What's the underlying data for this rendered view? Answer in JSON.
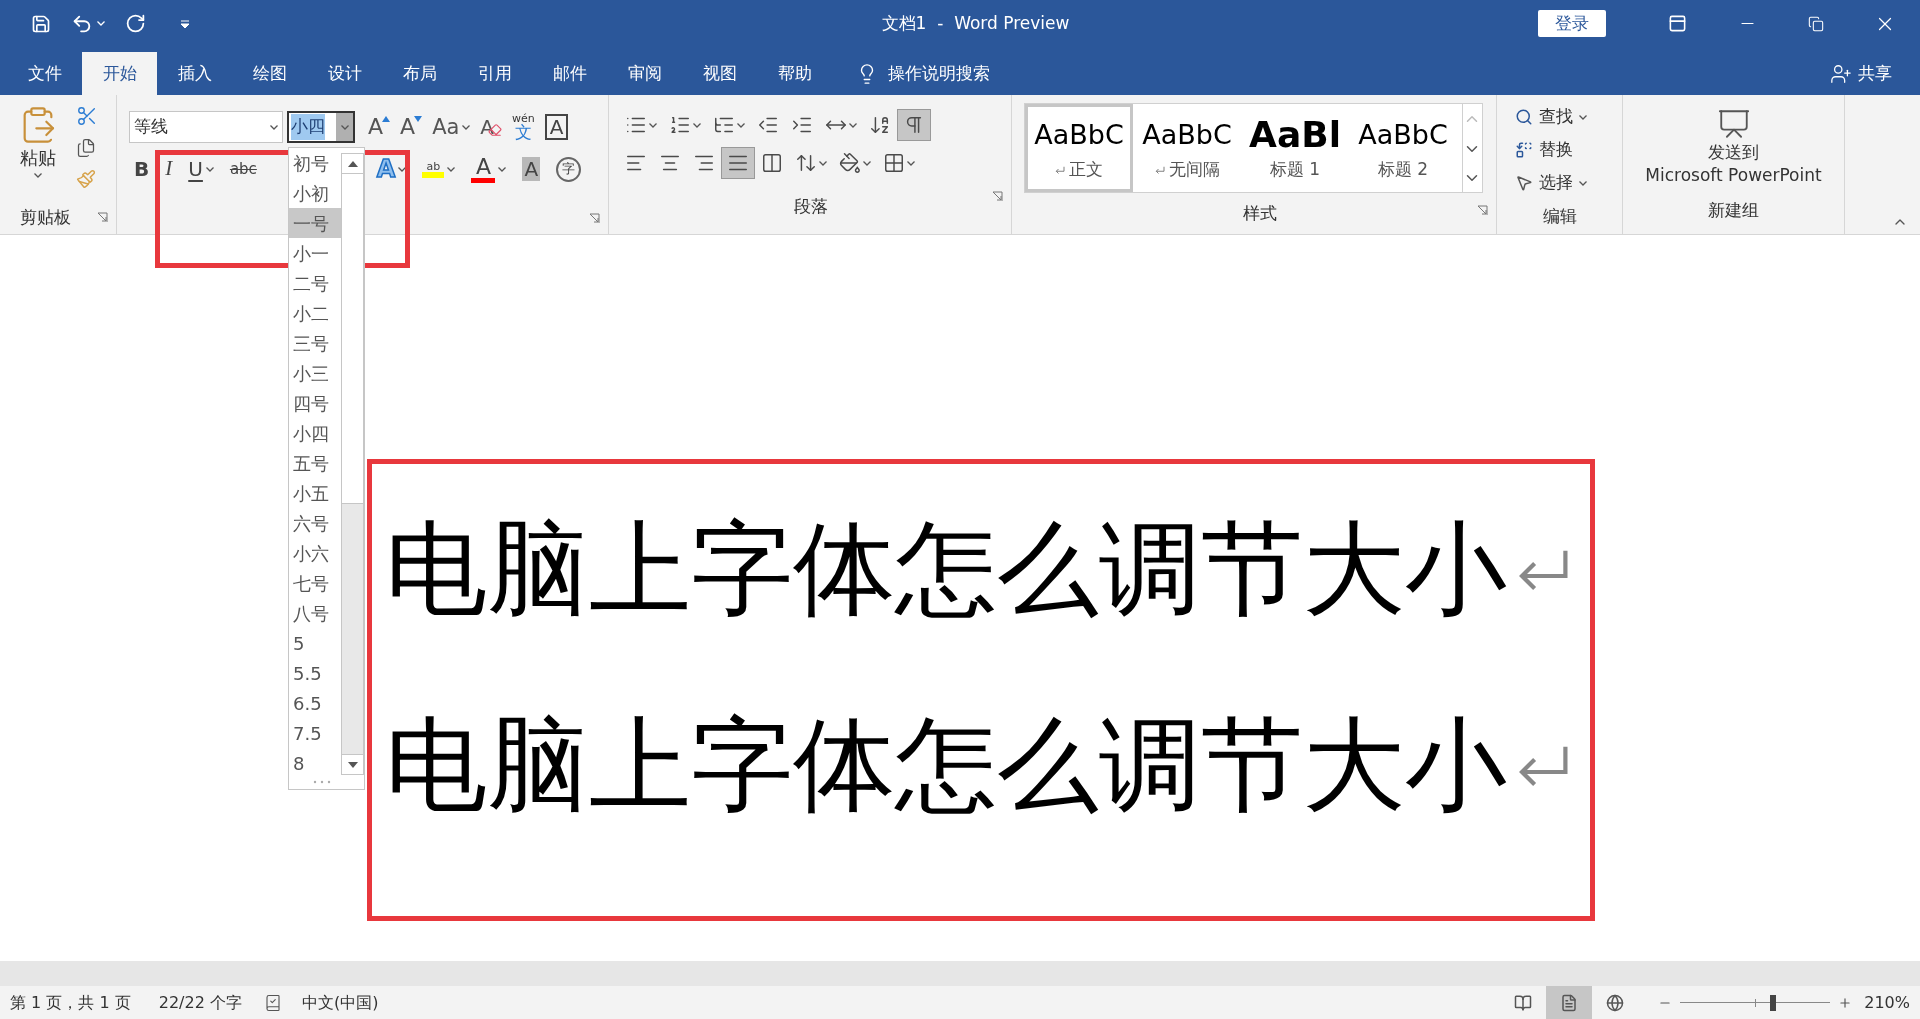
{
  "title_bar": {
    "title": "文档1  -  Word Preview",
    "sign_in": "登录"
  },
  "tabs": [
    {
      "label": "文件",
      "selected": false
    },
    {
      "label": "开始",
      "selected": true
    },
    {
      "label": "插入",
      "selected": false
    },
    {
      "label": "绘图",
      "selected": false
    },
    {
      "label": "设计",
      "selected": false
    },
    {
      "label": "布局",
      "selected": false
    },
    {
      "label": "引用",
      "selected": false
    },
    {
      "label": "邮件",
      "selected": false
    },
    {
      "label": "审阅",
      "selected": false
    },
    {
      "label": "视图",
      "selected": false
    },
    {
      "label": "帮助",
      "selected": false
    }
  ],
  "tell_me": "操作说明搜索",
  "share": "共享",
  "clipboard": {
    "paste": "粘贴",
    "label": "剪贴板"
  },
  "font_group": {
    "name": "等线",
    "size": "小四",
    "row1": [
      {
        "kind": "grow",
        "glyph": "A",
        "menu": false
      },
      {
        "kind": "shrink",
        "glyph": "A",
        "menu": false
      },
      {
        "kind": "case",
        "glyph": "Aa",
        "menu": true
      },
      {
        "kind": "clear",
        "glyph": "A",
        "menu": false
      },
      {
        "kind": "phonetic",
        "glyph": "文",
        "ruby": "wén",
        "menu": false
      },
      {
        "kind": "border",
        "glyph": "A",
        "menu": false
      }
    ],
    "row2": [
      {
        "kind": "bold",
        "glyph": "B",
        "menu": false
      },
      {
        "kind": "italic",
        "glyph": "I",
        "menu": false
      },
      {
        "kind": "underline",
        "glyph": "U",
        "menu": true
      },
      {
        "kind": "strike",
        "glyph": "abc",
        "menu": false
      },
      {
        "kind": "gap"
      },
      {
        "kind": "effects",
        "glyph": "A",
        "menu": true
      },
      {
        "kind": "highlight",
        "glyph": "ab",
        "menu": true
      },
      {
        "kind": "color",
        "glyph": "A",
        "menu": true
      },
      {
        "kind": "shading",
        "glyph": "A",
        "menu": false
      },
      {
        "kind": "enclose",
        "glyph": "字",
        "menu": false
      }
    ]
  },
  "size_list": [
    {
      "label": "初号",
      "selected": false
    },
    {
      "label": "小初",
      "selected": false
    },
    {
      "label": "一号",
      "selected": true
    },
    {
      "label": "小一",
      "selected": false
    },
    {
      "label": "二号",
      "selected": false
    },
    {
      "label": "小二",
      "selected": false
    },
    {
      "label": "三号",
      "selected": false
    },
    {
      "label": "小三",
      "selected": false
    },
    {
      "label": "四号",
      "selected": false
    },
    {
      "label": "小四",
      "selected": false
    },
    {
      "label": "五号",
      "selected": false
    },
    {
      "label": "小五",
      "selected": false
    },
    {
      "label": "六号",
      "selected": false
    },
    {
      "label": "小六",
      "selected": false
    },
    {
      "label": "七号",
      "selected": false
    },
    {
      "label": "八号",
      "selected": false
    },
    {
      "label": "5",
      "selected": false
    },
    {
      "label": "5.5",
      "selected": false
    },
    {
      "label": "6.5",
      "selected": false
    },
    {
      "label": "7.5",
      "selected": false
    },
    {
      "label": "8",
      "selected": false
    }
  ],
  "paragraph_group": {
    "label": "段落",
    "row1": [
      {
        "kind": "bullets",
        "menu": true,
        "selected": false
      },
      {
        "kind": "numbering",
        "menu": true,
        "selected": false
      },
      {
        "kind": "multilevel",
        "menu": true,
        "selected": false
      },
      {
        "kind": "outdent",
        "menu": false,
        "selected": false
      },
      {
        "kind": "indent",
        "menu": false,
        "selected": false
      },
      {
        "kind": "asian",
        "menu": true,
        "selected": false
      },
      {
        "kind": "sort",
        "menu": false,
        "selected": false
      },
      {
        "kind": "marks",
        "menu": false,
        "selected": true
      }
    ],
    "row2": [
      {
        "kind": "left",
        "menu": false,
        "selected": false
      },
      {
        "kind": "center",
        "menu": false,
        "selected": false
      },
      {
        "kind": "right",
        "menu": false,
        "selected": false
      },
      {
        "kind": "justify",
        "menu": false,
        "selected": true
      },
      {
        "kind": "distribute",
        "menu": false,
        "selected": false
      },
      {
        "kind": "spacing",
        "menu": true,
        "selected": false
      },
      {
        "kind": "shading",
        "menu": true,
        "selected": false
      },
      {
        "kind": "borders",
        "menu": true,
        "selected": false
      }
    ]
  },
  "styles_group": {
    "label": "样式",
    "styles": [
      {
        "preview": "AaBbC",
        "name": "正文",
        "kind": "normal",
        "mark": true,
        "selected": true
      },
      {
        "preview": "AaBbC",
        "name": "无间隔",
        "kind": "normal",
        "mark": true,
        "selected": false
      },
      {
        "preview": "AaBl",
        "name": "标题 1",
        "kind": "heading",
        "mark": false,
        "selected": false
      },
      {
        "preview": "AaBbC",
        "name": "标题 2",
        "kind": "normal",
        "mark": false,
        "selected": false
      }
    ]
  },
  "editing_group": {
    "label": "编辑",
    "items": [
      {
        "kind": "find",
        "label": "查找",
        "menu": true
      },
      {
        "kind": "replace",
        "label": "替换",
        "menu": false
      },
      {
        "kind": "select",
        "label": "选择",
        "menu": true
      }
    ]
  },
  "new_group": {
    "label": "新建组",
    "button": [
      "发送到",
      "Microsoft PowerPoint"
    ]
  },
  "document": {
    "lines": [
      "电脑上字体怎么调节大小",
      "电脑上字体怎么调节大小"
    ]
  },
  "status_bar": {
    "page": "第 1 页，共 1 页",
    "words": "22/22 个字",
    "language": "中文(中国)",
    "views": [
      {
        "kind": "read",
        "selected": false
      },
      {
        "kind": "print",
        "selected": true
      },
      {
        "kind": "web",
        "selected": false
      }
    ],
    "zoom": {
      "level": 0.62,
      "reading": "210%"
    }
  }
}
